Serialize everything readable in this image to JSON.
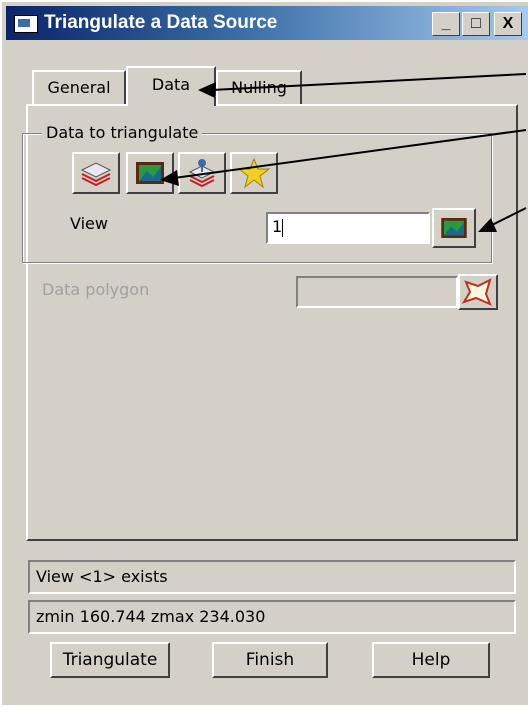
{
  "window": {
    "title": "Triangulate a Data Source",
    "minimize_glyph": "_",
    "maximize_glyph": "□",
    "close_glyph": "X"
  },
  "tabs": [
    {
      "label": "General",
      "active": false
    },
    {
      "label": "Data",
      "active": true
    },
    {
      "label": "Nulling",
      "active": false
    }
  ],
  "group": {
    "label": "Data to triangulate",
    "icons": [
      "layers-icon",
      "view-icon",
      "model-icon",
      "star-icon"
    ]
  },
  "view": {
    "label": "View",
    "value": "1"
  },
  "data_polygon": {
    "label": "Data polygon",
    "value": "",
    "enabled": false
  },
  "status": {
    "line1": "View <1> exists",
    "line2": "zmin 160.744 zmax 234.030"
  },
  "buttons": {
    "triangulate": "Triangulate",
    "finish": "Finish",
    "help": "Help"
  },
  "colors": {
    "title_bar": "#0a246a",
    "dialog_face": "#d4d0c8",
    "disabled_text": "#a0a0a0"
  }
}
